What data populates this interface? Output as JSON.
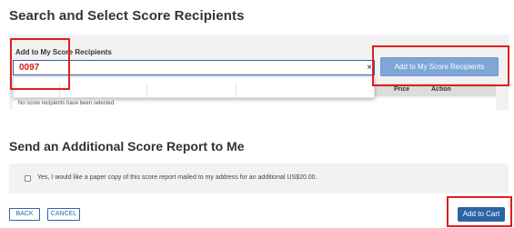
{
  "page": {
    "title": "Search and Select Score Recipients"
  },
  "recipients": {
    "add_label": "Add to My Score Recipients",
    "search_value": "0097",
    "clear_glyph": "×",
    "add_button_label": "Add to My Score Recipients",
    "columns": [
      "Price",
      "Action"
    ],
    "empty_text": "No score recipients have been selected."
  },
  "paper_copy": {
    "heading": "Send an Additional Score Report to Me",
    "checkbox_label": "Yes, I would like a paper copy of this score report mailed to my address for an additional US$20.00."
  },
  "footer": {
    "back_label": "BACK",
    "cancel_label": "CANCEL",
    "add_to_cart_label": "Add to Cart"
  },
  "colors": {
    "primary": "#2b64a6",
    "disabled_button": "#7ea6d8",
    "annotation_box": "#e01e1e",
    "input_text": "#d11a1a"
  }
}
